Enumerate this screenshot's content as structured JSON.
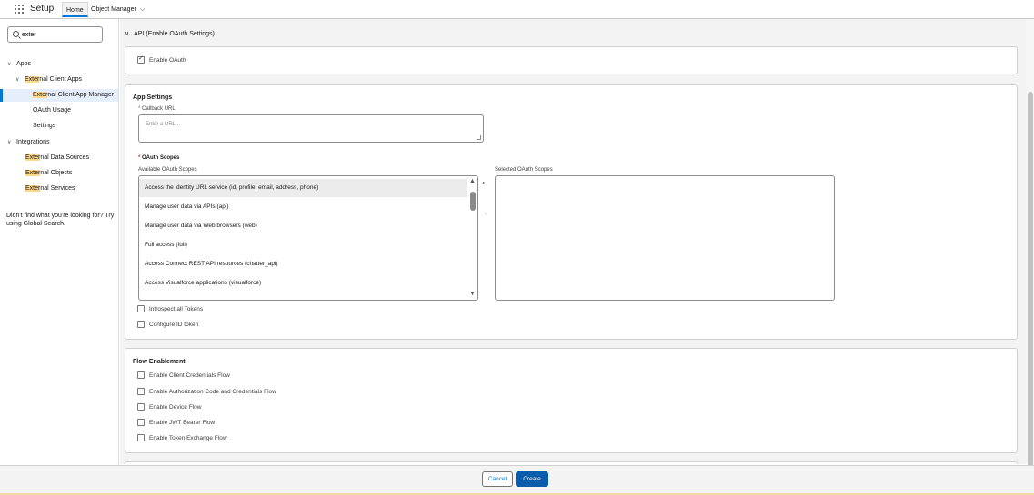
{
  "header": {
    "app_name": "Setup",
    "tabs": [
      {
        "label": "Home"
      },
      {
        "label": "Object Manager"
      }
    ]
  },
  "sidebar": {
    "search": {
      "value": "exter",
      "highlight": "Exter"
    },
    "tree": [
      {
        "label": "Apps",
        "level": 0,
        "expanded": true
      },
      {
        "label_pre": "Exter",
        "label_post": "nal Client Apps",
        "level": 1,
        "expanded": true
      },
      {
        "label_pre": "Exter",
        "label_post": "nal Client App Manager",
        "level": 2,
        "selected": true
      },
      {
        "label": "OAuth Usage",
        "level": 2
      },
      {
        "label": "Settings",
        "level": 2
      },
      {
        "label": "Integrations",
        "level": 0,
        "expanded": true
      },
      {
        "label_pre": "Exter",
        "label_post": "nal Data Sources",
        "level": 1
      },
      {
        "label_pre": "Exter",
        "label_post": "nal Objects",
        "level": 1
      },
      {
        "label_pre": "Exter",
        "label_post": "nal Services",
        "level": 1
      }
    ],
    "hint": "Didn't find what you're looking for? Try using Global Search."
  },
  "main": {
    "section_title": "API (Enable OAuth Settings)",
    "enable_oauth": {
      "label": "Enable OAuth",
      "checked": true
    },
    "app_settings": {
      "heading": "App Settings",
      "callback_url": {
        "label": "Callback URL",
        "required": "*",
        "placeholder": "Enter a URL..."
      },
      "oauth_scopes": {
        "label": "OAuth Scopes",
        "required": "*",
        "available_label": "Available OAuth Scopes",
        "selected_label": "Selected OAuth Scopes",
        "available": [
          "Access the identity URL service (id, profile, email, address, phone)",
          "Manage user data via APIs (api)",
          "Manage user data via Web browsers (web)",
          "Full access (full)",
          "Access Connect REST API resources (chatter_api)",
          "Access Visualforce applications (visualforce)"
        ],
        "selected": []
      },
      "introspect_tokens": {
        "label": "Introspect all Tokens",
        "checked": false
      },
      "configure_id_token": {
        "label": "Configure ID token",
        "checked": false
      }
    },
    "flow_enablement": {
      "heading": "Flow Enablement",
      "options": [
        {
          "label": "Enable Client Credentials Flow",
          "checked": false
        },
        {
          "label": "Enable Authorization Code and Credentials Flow",
          "checked": false
        },
        {
          "label": "Enable Device Flow",
          "checked": false
        },
        {
          "label": "Enable JWT Bearer Flow",
          "checked": false
        },
        {
          "label": "Enable Token Exchange Flow",
          "checked": false
        }
      ]
    }
  },
  "footer": {
    "cancel_label": "Cancel",
    "create_label": "Create"
  },
  "colors": {
    "brand": "#0b5cab",
    "link": "#0176d3",
    "highlight": "#fdd98f"
  }
}
